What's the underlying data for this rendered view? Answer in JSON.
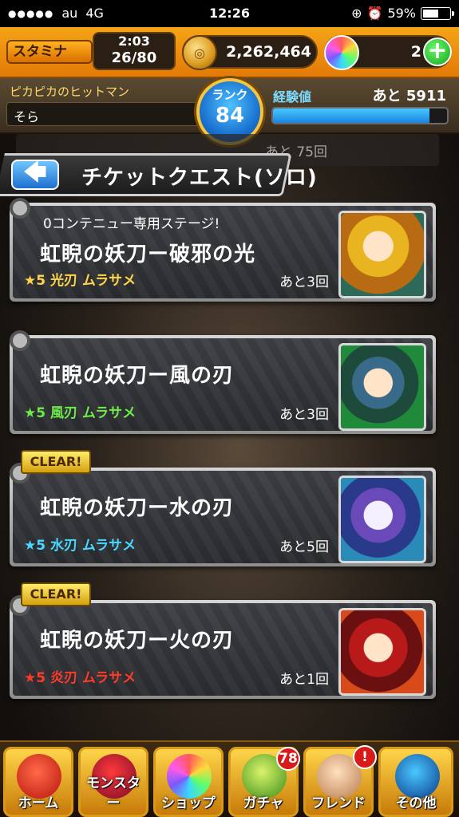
{
  "status_bar": {
    "carrier": "au",
    "network": "4G",
    "time": "12:26",
    "battery": "59%",
    "battery_level": 0.59
  },
  "header": {
    "stamina_label": "スタミナ",
    "stamina_timer": "2:03",
    "stamina_count": "26/80",
    "stamina_level": 0.325,
    "coins": "2,262,464",
    "orbs": "2",
    "plus_label": "+"
  },
  "player": {
    "title": "ピカピカのヒットマン",
    "name": "そら",
    "rank_label": "ランク",
    "rank": "84",
    "exp_label": "経験値",
    "exp_remaining": "あと 5911",
    "exp_progress": 0.9
  },
  "sub_header": {
    "title": "チケットクエスト(ソロ)"
  },
  "ghost_row": {
    "remain": "あと 75回"
  },
  "quests": [
    {
      "subtitle": "0コンテニュー専用ステージ!",
      "name": "虹睨の妖刀ー破邪の光",
      "stars": "★5",
      "element": "光刃",
      "monster": "ムラサメ",
      "remain": "あと3回",
      "clear": "",
      "color": "#ffd64a"
    },
    {
      "subtitle": "",
      "name": "虹睨の妖刀ー風の刃",
      "stars": "★5",
      "element": "風刃",
      "monster": "ムラサメ",
      "remain": "あと3回",
      "clear": "",
      "color": "#6eea4a"
    },
    {
      "subtitle": "",
      "name": "虹睨の妖刀ー水の刃",
      "stars": "★5",
      "element": "水刃",
      "monster": "ムラサメ",
      "remain": "あと5回",
      "clear": "CLEAR!",
      "color": "#4ad8ff"
    },
    {
      "subtitle": "",
      "name": "虹睨の妖刀ー火の刃",
      "stars": "★5",
      "element": "炎刃",
      "monster": "ムラサメ",
      "remain": "あと1回",
      "clear": "CLEAR!",
      "color": "#ff3a2a"
    }
  ],
  "nav": {
    "home": "ホーム",
    "monster": "モンスター",
    "shop": "ショップ",
    "gacha": "ガチャ",
    "gacha_badge": "78",
    "friend": "フレンド",
    "friend_badge": "!",
    "other": "その他"
  }
}
